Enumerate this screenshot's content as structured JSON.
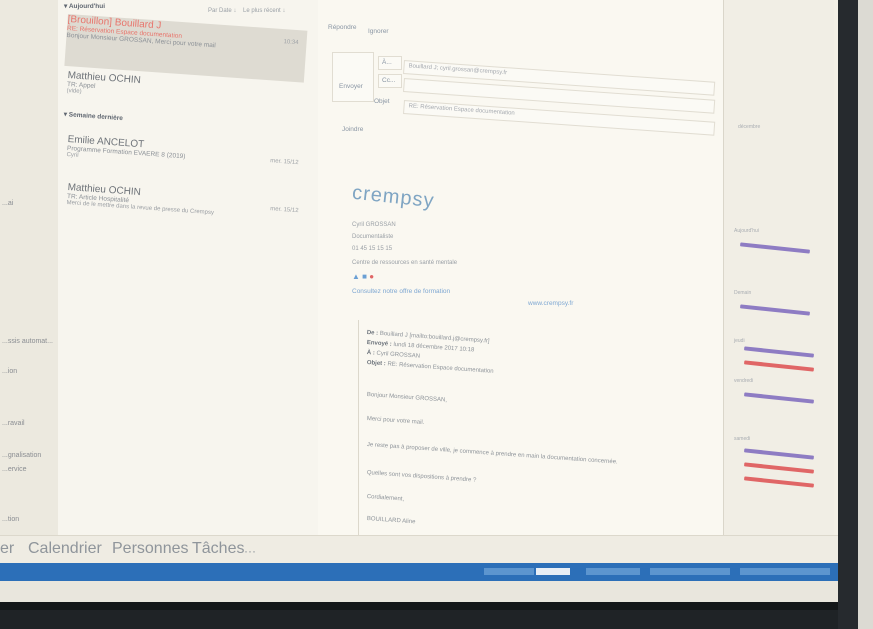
{
  "folders": [
    {
      "label": "...ai"
    },
    {
      "label": "...ssis automat..."
    },
    {
      "label": "...ion"
    },
    {
      "label": "...ravail"
    },
    {
      "label": "...gnalisation"
    },
    {
      "label": "...ervice"
    },
    {
      "label": "...tion"
    }
  ],
  "message_list": {
    "toolbar": {
      "sort": "Par Date ↓",
      "order": "Le plus récent ↓"
    },
    "groups": [
      {
        "label": "▾ Aujourd'hui"
      },
      {
        "label": "▾ Semaine dernière"
      }
    ],
    "messages": [
      {
        "sender": "[Brouillon] Bouillard J",
        "subject": "RE: Réservation Espace documentation",
        "preview": "Bonjour Monsieur GROSSAN, Merci pour votre mail",
        "date": "10:34",
        "draft": true,
        "selected": true
      },
      {
        "sender": "Matthieu OCHIN",
        "subject": "TR: Appel",
        "preview": "(vide)",
        "date": "",
        "draft": false,
        "selected": false
      },
      {
        "sender": "Emilie ANCELOT",
        "subject": "Programme Formation EVAERE 8 (2019)",
        "preview": "Cyril",
        "date": "mer. 15/12",
        "draft": false,
        "selected": false
      },
      {
        "sender": "Matthieu OCHIN",
        "subject": "TR: Article Hospitalité",
        "preview": "Merci de le mettre dans la revue de presse du Crempsy",
        "date": "mer. 15/12",
        "draft": false,
        "selected": false
      }
    ]
  },
  "reading": {
    "ribbon": {
      "reply": "Répondre",
      "ignore": "Ignorer"
    },
    "to_label": "À...",
    "cc_label": "Cc...",
    "send_label": "Envoyer",
    "object_label": "Objet",
    "to_value": "Bouillard J; cyril.grossan@crempsy.fr",
    "object_value": "RE: Réservation Espace documentation",
    "attachment_hint": "Joindre",
    "logo_text": "crempsy",
    "signature": [
      "Cyril GROSSAN",
      "Documentaliste",
      "01 45 15 15 15",
      "Centre de ressources en santé mentale"
    ],
    "links": [
      "Consultez notre offre de formation",
      "www.crempsy.fr"
    ],
    "quoted": {
      "from_label": "De :",
      "from_value": "Bouillard J [mailto:bouillard.j@crempsy.fr]",
      "sent_label": "Envoyé :",
      "sent_value": "lundi 18 décembre 2017 10:18",
      "to_label": "À :",
      "to_value": "Cyril GROSSAN",
      "subject_label": "Objet :",
      "subject_value": "RE: Réservation Espace documentation",
      "body": [
        "Bonjour Monsieur GROSSAN,",
        "Merci pour votre mail.",
        "Je reste pas à proposer de ville, je commence à prendre en main la documentation concernée.",
        "Quelles sont vos dispositions à prendre ?",
        "Cordialement,",
        "BOUILLARD Aline"
      ]
    }
  },
  "peek": {
    "labels": [
      "décembre",
      "Aujourd'hui",
      "Demain",
      "jeudi",
      "vendredi",
      "samedi"
    ],
    "event_colors": [
      "#8e7cc3",
      "#e06666"
    ]
  },
  "nav": {
    "items": [
      "er",
      "Calendrier",
      "Personnes",
      "Tâches",
      "···"
    ]
  },
  "taskbar": {
    "icons": [
      {
        "name": "start-icon",
        "color": "#3a8fd6"
      },
      {
        "name": "excel-icon",
        "color": "#1f9d55"
      },
      {
        "name": "word-icon",
        "color": "#2b62b8"
      },
      {
        "name": "publisher-icon",
        "color": "#1f8a6b"
      },
      {
        "name": "outlook-icon",
        "color": "#2a6ebd"
      },
      {
        "name": "powerpoint-icon",
        "color": "#d24726"
      },
      {
        "name": "onenote-icon",
        "color": "#8e44ad"
      }
    ]
  }
}
